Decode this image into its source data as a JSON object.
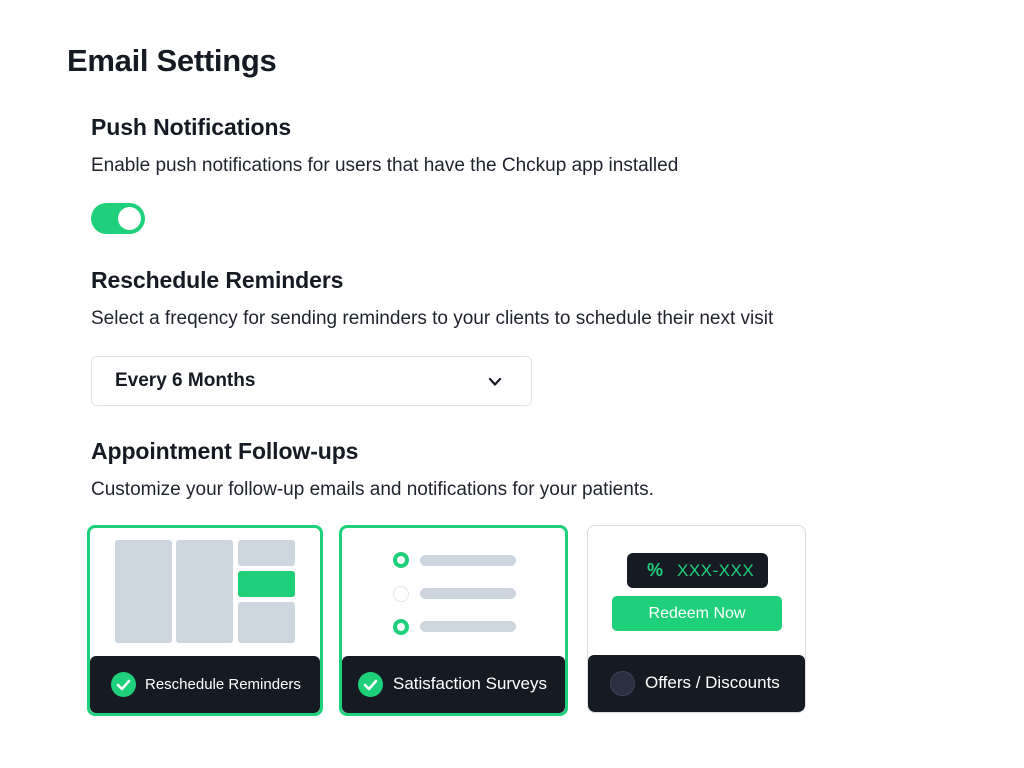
{
  "page": {
    "title": "Email Settings"
  },
  "push_notifications": {
    "title": "Push Notifications",
    "description": "Enable push notifications for users that have the Chckup app installed",
    "enabled": true
  },
  "reschedule_reminders": {
    "title": "Reschedule Reminders",
    "description": "Select a freqency for sending reminders to your clients to schedule their next visit",
    "selected_value": "Every 6 Months"
  },
  "appointment_followups": {
    "title": "Appointment Follow-ups",
    "description": "Customize your follow-up emails and notifications for your patients.",
    "cards": [
      {
        "label": "Reschedule Reminders",
        "selected": true
      },
      {
        "label": "Satisfaction Surveys",
        "selected": true
      },
      {
        "label": "Offers / Discounts",
        "selected": false,
        "coupon_code": "XXX-XXX",
        "coupon_symbol": "%",
        "redeem_label": "Redeem Now"
      }
    ]
  },
  "colors": {
    "accent": "#1fd07a",
    "dark": "#161a23",
    "placeholder": "#cdd5de"
  }
}
